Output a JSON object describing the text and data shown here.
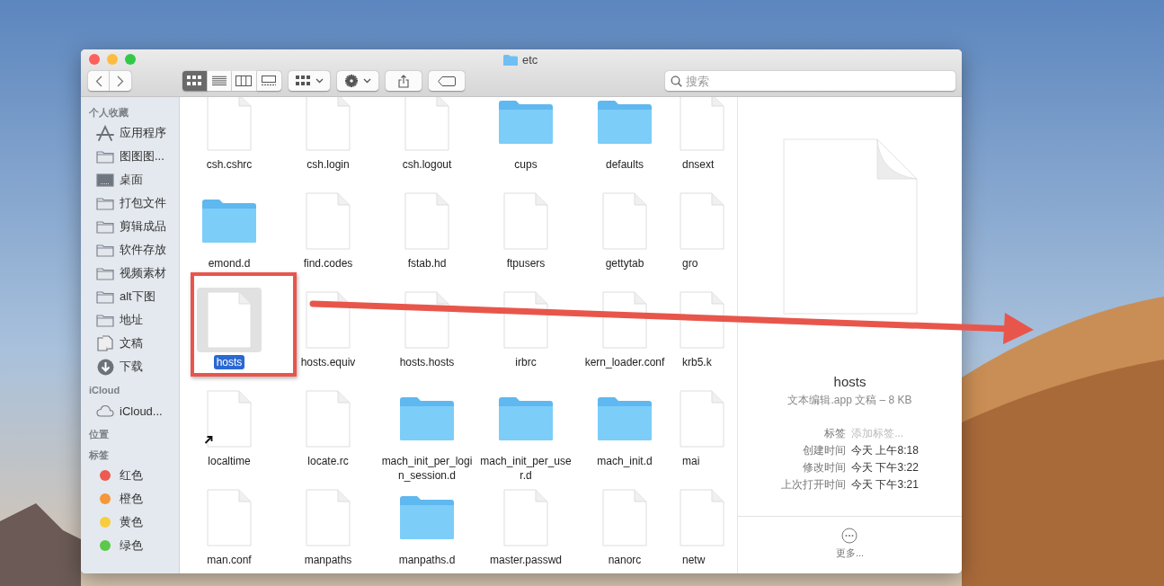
{
  "window": {
    "title": "etc"
  },
  "toolbar": {
    "view_modes": [
      {
        "kind": "icons",
        "selected": true
      },
      {
        "kind": "list",
        "selected": false
      },
      {
        "kind": "columns",
        "selected": false
      },
      {
        "kind": "gallery",
        "selected": false
      }
    ]
  },
  "search": {
    "placeholder": "搜索"
  },
  "sidebar": {
    "sections": [
      {
        "title": "个人收藏",
        "items": [
          {
            "label": "应用程序",
            "kind": "apps"
          },
          {
            "label": "图图图...",
            "kind": "folder"
          },
          {
            "label": "桌面",
            "kind": "desktop"
          },
          {
            "label": "打包文件",
            "kind": "folder"
          },
          {
            "label": "剪辑成品",
            "kind": "folder"
          },
          {
            "label": "软件存放",
            "kind": "folder"
          },
          {
            "label": "视频素材",
            "kind": "folder"
          },
          {
            "label": "alt下图",
            "kind": "folder"
          },
          {
            "label": "地址",
            "kind": "folder"
          },
          {
            "label": "文稿",
            "kind": "docs"
          },
          {
            "label": "下载",
            "kind": "download"
          }
        ]
      },
      {
        "title": "iCloud",
        "items": [
          {
            "label": "iCloud...",
            "kind": "cloud"
          }
        ]
      },
      {
        "title": "位置"
      },
      {
        "title": "标签",
        "items": [
          {
            "label": "红色",
            "kind": "tag",
            "color": "#ee5a50"
          },
          {
            "label": "橙色",
            "kind": "tag",
            "color": "#f5973a"
          },
          {
            "label": "黄色",
            "kind": "tag",
            "color": "#f7cd3e"
          },
          {
            "label": "绿色",
            "kind": "tag",
            "color": "#5bc94a"
          }
        ]
      }
    ]
  },
  "files": [
    {
      "name": "csh.cshrc",
      "kind": "file",
      "selected": false,
      "alias": false
    },
    {
      "name": "csh.login",
      "kind": "file",
      "selected": false,
      "alias": false
    },
    {
      "name": "csh.logout",
      "kind": "file",
      "selected": false,
      "alias": false
    },
    {
      "name": "cups",
      "kind": "folder",
      "selected": false,
      "alias": false
    },
    {
      "name": "defaults",
      "kind": "folder",
      "selected": false,
      "alias": false
    },
    {
      "name": "dnsext",
      "kind": "file",
      "selected": false,
      "alias": false
    },
    {
      "name": "emond.d",
      "kind": "folder",
      "selected": false,
      "alias": false
    },
    {
      "name": "find.codes",
      "kind": "file",
      "selected": false,
      "alias": false
    },
    {
      "name": "fstab.hd",
      "kind": "file",
      "selected": false,
      "alias": false
    },
    {
      "name": "ftpusers",
      "kind": "file",
      "selected": false,
      "alias": false
    },
    {
      "name": "gettytab",
      "kind": "file",
      "selected": false,
      "alias": false
    },
    {
      "name": "gro",
      "kind": "file",
      "selected": false,
      "alias": false
    },
    {
      "name": "hosts",
      "kind": "file",
      "selected": true,
      "alias": false
    },
    {
      "name": "hosts.equiv",
      "kind": "file",
      "selected": false,
      "alias": false
    },
    {
      "name": "hosts.hosts",
      "kind": "file",
      "selected": false,
      "alias": false
    },
    {
      "name": "irbrc",
      "kind": "file",
      "selected": false,
      "alias": false
    },
    {
      "name": "kern_loader.conf",
      "kind": "file",
      "selected": false,
      "alias": false
    },
    {
      "name": "krb5.k",
      "kind": "file",
      "selected": false,
      "alias": false
    },
    {
      "name": "localtime",
      "kind": "file",
      "selected": false,
      "alias": true
    },
    {
      "name": "locate.rc",
      "kind": "file",
      "selected": false,
      "alias": false
    },
    {
      "name": "mach_init_per_login_session.d",
      "kind": "folder",
      "selected": false,
      "alias": false
    },
    {
      "name": "mach_init_per_user.d",
      "kind": "folder",
      "selected": false,
      "alias": false
    },
    {
      "name": "mach_init.d",
      "kind": "folder",
      "selected": false,
      "alias": false
    },
    {
      "name": "mai",
      "kind": "file",
      "selected": false,
      "alias": false
    },
    {
      "name": "man.conf",
      "kind": "file",
      "selected": false,
      "alias": false
    },
    {
      "name": "manpaths",
      "kind": "file",
      "selected": false,
      "alias": false
    },
    {
      "name": "manpaths.d",
      "kind": "folder",
      "selected": false,
      "alias": false
    },
    {
      "name": "master.passwd",
      "kind": "file",
      "selected": false,
      "alias": false
    },
    {
      "name": "nanorc",
      "kind": "file",
      "selected": false,
      "alias": false
    },
    {
      "name": "netw",
      "kind": "file",
      "selected": false,
      "alias": false
    }
  ],
  "preview": {
    "name": "hosts",
    "info": "文本编辑.app 文稿 – 8 KB",
    "details": [
      {
        "label": "标签",
        "placeholder": "添加标签...",
        "kind": "placeholder"
      },
      {
        "label": "创建时间",
        "value": "今天 上午8:18",
        "kind": "value"
      },
      {
        "label": "修改时间",
        "value": "今天 下午3:22",
        "kind": "value"
      },
      {
        "label": "上次打开时间",
        "value": "今天 下午3:21",
        "kind": "value"
      }
    ],
    "more": "更多..."
  }
}
